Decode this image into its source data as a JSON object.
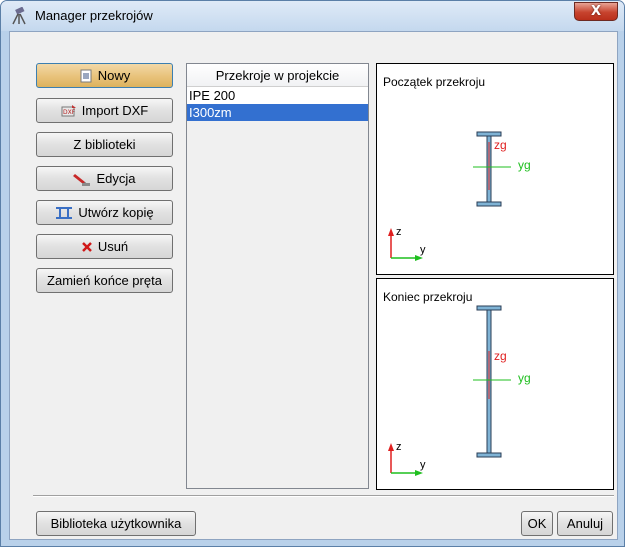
{
  "window": {
    "title": "Manager przekrojów",
    "close_symbol": "X",
    "icon": "tripod-icon"
  },
  "buttons": {
    "nowy": {
      "label": "Nowy",
      "icon": "new-document-icon"
    },
    "import_dxf": {
      "label": "Import DXF",
      "icon": "dxf-import-icon"
    },
    "z_biblioteki": {
      "label": "Z biblioteki"
    },
    "edycja": {
      "label": "Edycja",
      "icon": "pencil-edit-icon"
    },
    "utworz_kopie": {
      "label": "Utwórz kopię",
      "icon": "copy-section-icon"
    },
    "usun": {
      "label": "Usuń",
      "icon": "red-x-icon"
    },
    "zamien": {
      "label": "Zamień końce pręta"
    }
  },
  "section_list": {
    "header": "Przekroje w projekcie",
    "items": [
      {
        "label": "IPE 200",
        "selected": false
      },
      {
        "label": "I300zm",
        "selected": true
      }
    ]
  },
  "preview_start": {
    "label": "Początek przekroju",
    "zg": "zg",
    "yg": "yg",
    "z": "z",
    "y": "y"
  },
  "preview_end": {
    "label": "Koniec przekroju",
    "zg": "zg",
    "yg": "yg",
    "z": "z",
    "y": "y"
  },
  "footer": {
    "user_library": "Biblioteka użytkownika",
    "ok": "OK",
    "cancel": "Anuluj"
  },
  "colors": {
    "selection": "#3370d0",
    "section_fill": "#7fb3d5",
    "axis_red": "#e02020",
    "axis_green": "#1fbf1f",
    "close_red": "#c7432e"
  }
}
